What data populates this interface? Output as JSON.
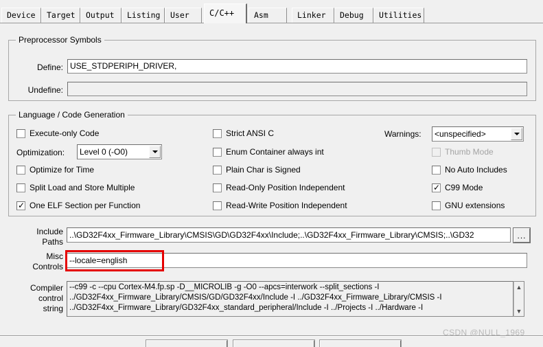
{
  "window": {
    "watermark": "CSDN @NULL_1969"
  },
  "tabs": [
    {
      "label": "Device",
      "active": false
    },
    {
      "label": "Target",
      "active": false
    },
    {
      "label": "Output",
      "active": false
    },
    {
      "label": "Listing",
      "active": false
    },
    {
      "label": "User",
      "active": false
    },
    {
      "label": "C/C++",
      "active": true
    },
    {
      "label": "Asm",
      "active": false
    },
    {
      "label": "Linker",
      "active": false
    },
    {
      "label": "Debug",
      "active": false
    },
    {
      "label": "Utilities",
      "active": false
    }
  ],
  "preprocessor": {
    "legend": "Preprocessor Symbols",
    "define_label": "Define:",
    "define_value": "USE_STDPERIPH_DRIVER,",
    "undefine_label": "Undefine:",
    "undefine_value": ""
  },
  "language": {
    "legend": "Language / Code Generation",
    "col1": [
      {
        "label": "Execute-only Code",
        "checked": false,
        "disabled": false
      },
      {
        "label": "Optimize for Time",
        "checked": false,
        "disabled": false
      },
      {
        "label": "Split Load and Store Multiple",
        "checked": false,
        "disabled": false
      },
      {
        "label": "One ELF Section per Function",
        "checked": true,
        "disabled": false
      }
    ],
    "optimization_label": "Optimization:",
    "optimization_value": "Level 0 (-O0)",
    "col2": [
      {
        "label": "Strict ANSI C",
        "checked": false,
        "disabled": false
      },
      {
        "label": "Enum Container always int",
        "checked": false,
        "disabled": false
      },
      {
        "label": "Plain Char is Signed",
        "checked": false,
        "disabled": false
      },
      {
        "label": "Read-Only Position Independent",
        "checked": false,
        "disabled": false
      },
      {
        "label": "Read-Write Position Independent",
        "checked": false,
        "disabled": false
      }
    ],
    "warnings_label": "Warnings:",
    "warnings_value": "<unspecified>",
    "col3": [
      {
        "label": "Thumb Mode",
        "checked": false,
        "disabled": true
      },
      {
        "label": "No Auto Includes",
        "checked": false,
        "disabled": false
      },
      {
        "label": "C99 Mode",
        "checked": true,
        "disabled": false
      },
      {
        "label": "GNU extensions",
        "checked": false,
        "disabled": false
      }
    ]
  },
  "include_paths": {
    "label_line1": "Include",
    "label_line2": "Paths",
    "value": "..\\GD32F4xx_Firmware_Library\\CMSIS\\GD\\GD32F4xx\\Include;..\\GD32F4xx_Firmware_Library\\CMSIS;..\\GD32",
    "browse_label": "..."
  },
  "misc_controls": {
    "label_line1": "Misc",
    "label_line2": "Controls",
    "value": "--locale=english",
    "highlight_color": "#e50000"
  },
  "compiler_control": {
    "label_line1": "Compiler",
    "label_line2": "control",
    "label_line3": "string",
    "lines": [
      "--c99 -c --cpu Cortex-M4.fp.sp -D__MICROLIB -g -O0 --apcs=interwork --split_sections -I",
      "../GD32F4xx_Firmware_Library/CMSIS/GD/GD32F4xx/Include -I ../GD32F4xx_Firmware_Library/CMSIS -I",
      "../GD32F4xx_Firmware_Library/GD32F4xx_standard_peripheral/Include -I ../Projects -I ../Hardware -I"
    ],
    "scroll_up_icon": "chevron-up-icon",
    "scroll_down_icon": "chevron-down-icon"
  },
  "footer_buttons": [
    {
      "label": ""
    },
    {
      "label": ""
    },
    {
      "label": ""
    }
  ]
}
